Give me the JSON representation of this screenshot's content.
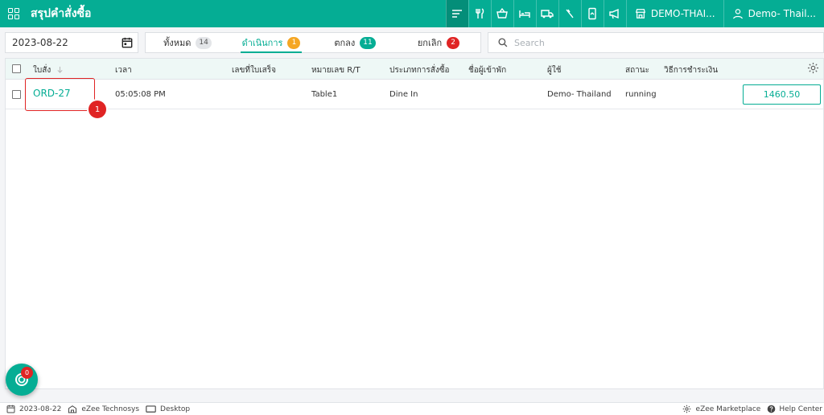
{
  "header": {
    "title": "สรุปคำสั่งซื้อ",
    "property_name": "DEMO-THAI...",
    "user_name": "Demo- Thail..."
  },
  "filters": {
    "date": "2023-08-22",
    "tabs": [
      {
        "label": "ทั้งหมด",
        "count": "14"
      },
      {
        "label": "ดำเนินการ",
        "count": "1"
      },
      {
        "label": "ตกลง",
        "count": "11"
      },
      {
        "label": "ยกเลิก",
        "count": "2"
      }
    ],
    "search_placeholder": "Search"
  },
  "table": {
    "columns": [
      "ใบสั่ง",
      "เวลา",
      "เลขที่ใบเสร็จ",
      "หมายเลข R/T",
      "ประเภทการสั่งซื้อ",
      "ชื่อผู้เข้าพัก",
      "ผู้ใช้",
      "สถานะ",
      "วิธีการชำระเงิน"
    ],
    "rows": [
      {
        "order": "ORD-27",
        "time": "05:05:08 PM",
        "receipt": "",
        "rt_number": "Table1",
        "order_type": "Dine In",
        "guest": "",
        "user": "Demo- Thailand",
        "status": "running",
        "payment": "",
        "amount": "1460.50"
      }
    ]
  },
  "annotation_marker": "1",
  "notifications": {
    "count": "0"
  },
  "footer": {
    "date": "2023-08-22",
    "company": "eZee Technosys",
    "mode": "Desktop",
    "marketplace": "eZee Marketplace",
    "help": "Help Center"
  },
  "colors": {
    "accent": "#05ad94",
    "danger": "#e02424",
    "warning": "#f5a623"
  }
}
